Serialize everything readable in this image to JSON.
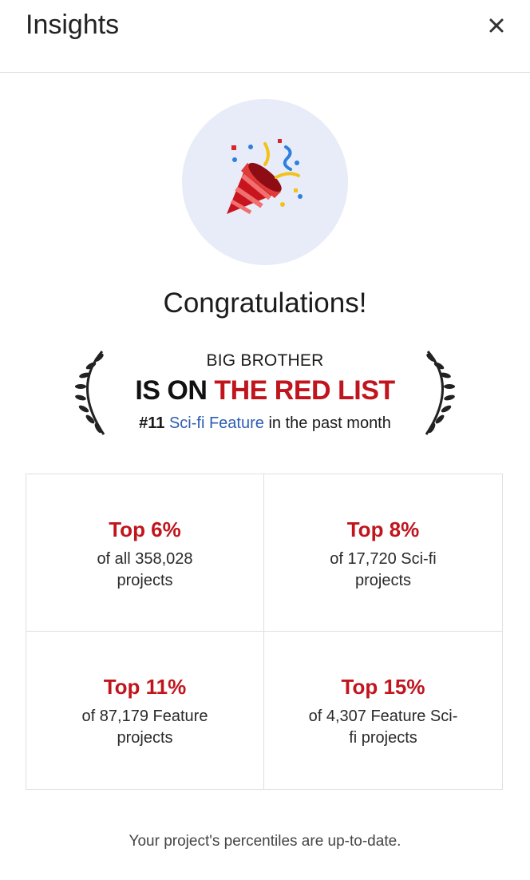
{
  "header": {
    "title": "Insights",
    "close_icon": "close-icon"
  },
  "badge": {
    "icon": "party-popper-icon",
    "background": "#e8ecf8"
  },
  "congrats": "Congratulations!",
  "award": {
    "project_name": "BIG BROTHER",
    "status_prefix": "IS ON",
    "status_highlight": "THE RED LIST",
    "rank": "#11",
    "category": "Sci-fi Feature",
    "period": "in the past month",
    "accent_red": "#c0151d",
    "accent_blue": "#2f5db3"
  },
  "stats": [
    {
      "percent": "Top 6%",
      "description": "of all 358,028 projects"
    },
    {
      "percent": "Top 8%",
      "description": "of 17,720 Sci-fi projects"
    },
    {
      "percent": "Top 11%",
      "description": "of 87,179 Feature projects"
    },
    {
      "percent": "Top 15%",
      "description": "of 4,307 Feature Sci-fi projects"
    }
  ],
  "footer": "Your project's percentiles are up-to-date."
}
